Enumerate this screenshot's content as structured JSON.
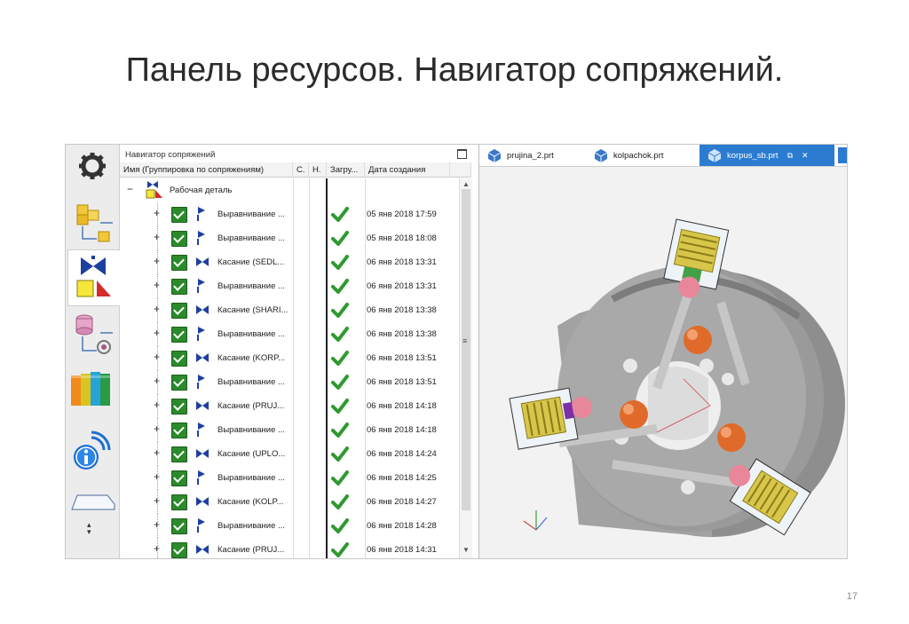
{
  "slide": {
    "title": "Панель ресурсов. Навигатор сопряжений.",
    "page_number": "17"
  },
  "resource_bar": {
    "items": [
      {
        "name": "gear-icon",
        "active": false
      },
      {
        "name": "assembly-navigator-icon",
        "active": false
      },
      {
        "name": "constraint-navigator-icon",
        "active": true
      },
      {
        "name": "part-navigator-icon",
        "active": false
      },
      {
        "name": "reuse-library-icon",
        "active": false
      },
      {
        "name": "info-icon",
        "active": false
      },
      {
        "name": "roles-icon",
        "active": false
      }
    ]
  },
  "navigator": {
    "title": "Навигатор сопряжений",
    "columns": {
      "name": "Имя (Группировка по сопряжениям)",
      "c": "С.",
      "n": "Н.",
      "loaded": "Загру...",
      "date": "Дата создания"
    },
    "root": {
      "label": "Рабочая деталь"
    },
    "rows": [
      {
        "name": "Выравнивание ...",
        "date": "05 янв 2018 17:59",
        "type": "align"
      },
      {
        "name": "Выравнивание ...",
        "date": "05 янв 2018 18:08",
        "type": "align"
      },
      {
        "name": "Касание (SEDL...",
        "date": "06 янв 2018 13:31",
        "type": "touch"
      },
      {
        "name": "Выравнивание ...",
        "date": "06 янв 2018 13:31",
        "type": "align"
      },
      {
        "name": "Касание (SHARI...",
        "date": "06 янв 2018 13:38",
        "type": "touch"
      },
      {
        "name": "Выравнивание ...",
        "date": "06 янв 2018 13:38",
        "type": "align"
      },
      {
        "name": "Касание (KORP...",
        "date": "06 янв 2018 13:51",
        "type": "touch"
      },
      {
        "name": "Выравнивание ...",
        "date": "06 янв 2018 13:51",
        "type": "align"
      },
      {
        "name": "Касание (PRUJ...",
        "date": "06 янв 2018 14:18",
        "type": "touch"
      },
      {
        "name": "Выравнивание ...",
        "date": "06 янв 2018 14:18",
        "type": "align"
      },
      {
        "name": "Касание (UPLO...",
        "date": "06 янв 2018 14:24",
        "type": "touch"
      },
      {
        "name": "Выравнивание ...",
        "date": "06 янв 2018 14:25",
        "type": "align"
      },
      {
        "name": "Касание (KOLP...",
        "date": "06 янв 2018 14:27",
        "type": "touch"
      },
      {
        "name": "Выравнивание ...",
        "date": "06 янв 2018 14:28",
        "type": "align"
      },
      {
        "name": "Касание (PRUJ...",
        "date": "06 янв 2018 14:31",
        "type": "touch"
      }
    ]
  },
  "viewport": {
    "tabs": [
      {
        "label": "prujina_2.prt",
        "active": false
      },
      {
        "label": "kolpachok.prt",
        "active": false
      },
      {
        "label": "korpus_sb.prt",
        "active": true
      }
    ],
    "colors": {
      "tab_active": "#2b7bd1",
      "body": "#9c9c9c",
      "spring": "#d8c64a",
      "ball": "#e06a2a"
    }
  }
}
